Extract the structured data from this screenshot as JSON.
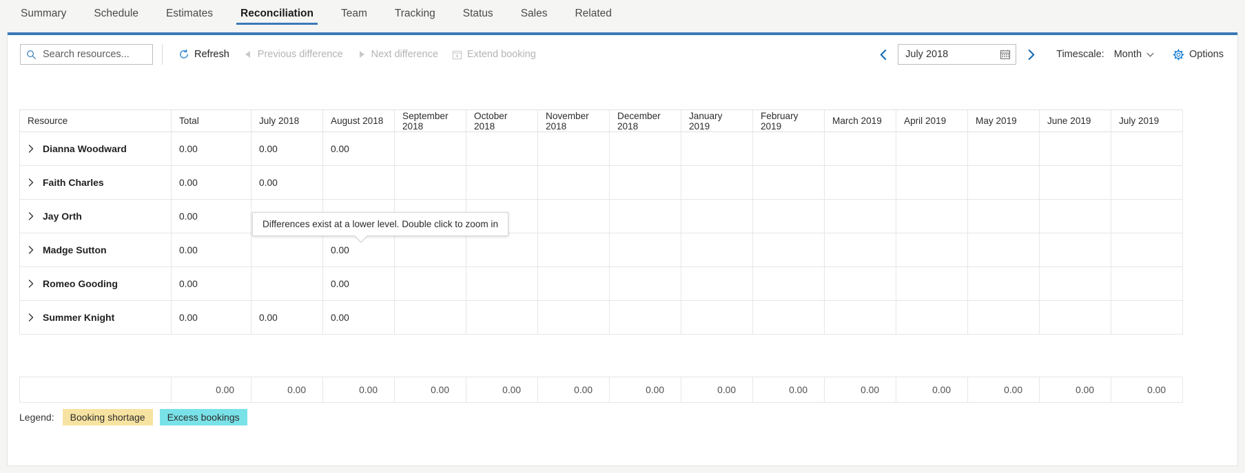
{
  "tabs": [
    {
      "label": "Summary",
      "active": false
    },
    {
      "label": "Schedule",
      "active": false
    },
    {
      "label": "Estimates",
      "active": false
    },
    {
      "label": "Reconciliation",
      "active": true
    },
    {
      "label": "Team",
      "active": false
    },
    {
      "label": "Tracking",
      "active": false
    },
    {
      "label": "Status",
      "active": false
    },
    {
      "label": "Sales",
      "active": false
    },
    {
      "label": "Related",
      "active": false
    }
  ],
  "toolbar": {
    "search_placeholder": "Search resources...",
    "search_value": "",
    "refresh_label": "Refresh",
    "previous_difference_label": "Previous difference",
    "next_difference_label": "Next difference",
    "extend_booking_label": "Extend booking",
    "date_value": "July 2018",
    "timescale_label": "Timescale:",
    "timescale_value": "Month",
    "options_label": "Options"
  },
  "grid": {
    "columns": [
      "Resource",
      "Total",
      "July 2018",
      "August 2018",
      "September 2018",
      "October 2018",
      "November 2018",
      "December 2018",
      "January 2019",
      "February 2019",
      "March 2019",
      "April 2019",
      "May 2019",
      "June 2019",
      "July 2019"
    ],
    "rows": [
      {
        "resource": "Dianna Woodward",
        "total": "0.00",
        "cells": [
          "0.00",
          "0.00",
          "",
          "",
          "",
          "",
          "",
          "",
          "",
          "",
          "",
          "",
          ""
        ],
        "flags": [
          false,
          false,
          false,
          false,
          false,
          false,
          false,
          false,
          false,
          false,
          false,
          false,
          false
        ]
      },
      {
        "resource": "Faith Charles",
        "total": "0.00",
        "cells": [
          "0.00",
          "",
          "",
          "",
          "",
          "",
          "",
          "",
          "",
          "",
          "",
          "",
          ""
        ],
        "flags": [
          false,
          false,
          false,
          false,
          false,
          false,
          false,
          false,
          false,
          false,
          false,
          false,
          false
        ]
      },
      {
        "resource": "Jay Orth",
        "total": "0.00",
        "cells": [
          "",
          "",
          "",
          "",
          "",
          "",
          "",
          "",
          "",
          "",
          "",
          "",
          ""
        ],
        "flags": [
          false,
          false,
          false,
          false,
          false,
          false,
          false,
          false,
          false,
          false,
          false,
          false,
          false
        ]
      },
      {
        "resource": "Madge Sutton",
        "total": "0.00",
        "cells": [
          "",
          "0.00",
          "",
          "",
          "",
          "",
          "",
          "",
          "",
          "",
          "",
          "",
          ""
        ],
        "flags": [
          false,
          true,
          false,
          false,
          false,
          false,
          false,
          false,
          false,
          false,
          false,
          false,
          false
        ]
      },
      {
        "resource": "Romeo Gooding",
        "total": "0.00",
        "cells": [
          "",
          "0.00",
          "",
          "",
          "",
          "",
          "",
          "",
          "",
          "",
          "",
          "",
          ""
        ],
        "flags": [
          false,
          true,
          false,
          false,
          false,
          false,
          false,
          false,
          false,
          false,
          false,
          false,
          false
        ]
      },
      {
        "resource": "Summer Knight",
        "total": "0.00",
        "cells": [
          "0.00",
          "0.00",
          "",
          "",
          "",
          "",
          "",
          "",
          "",
          "",
          "",
          "",
          ""
        ],
        "flags": [
          false,
          false,
          false,
          false,
          false,
          false,
          false,
          false,
          false,
          false,
          false,
          false,
          false
        ]
      }
    ],
    "totals_row": [
      "0.00",
      "0.00",
      "0.00",
      "0.00",
      "0.00",
      "0.00",
      "0.00",
      "0.00",
      "0.00",
      "0.00",
      "0.00",
      "0.00",
      "0.00",
      "0.00"
    ]
  },
  "tooltip": {
    "text": "Differences exist at a lower level. Double click to zoom in"
  },
  "legend": {
    "label": "Legend:",
    "items": [
      {
        "label": "Booking shortage",
        "color": "#f7e3a1"
      },
      {
        "label": "Excess bookings",
        "color": "#79e2e8"
      }
    ]
  },
  "colors": {
    "accent": "#3b79b8",
    "flag": "#d01a0f",
    "shortage": "#f7e3a1",
    "excess": "#79e2e8"
  }
}
